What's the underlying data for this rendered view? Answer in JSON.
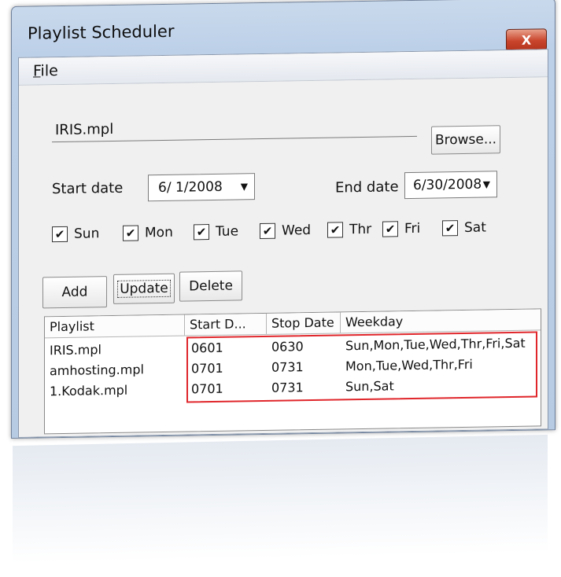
{
  "window": {
    "title": "Playlist Scheduler",
    "close_label": "X"
  },
  "menu": {
    "file_accel": "F",
    "file_rest": "ile"
  },
  "form": {
    "playlist_path": "IRIS.mpl",
    "browse_label": "Browse...",
    "start_date_label": "Start date",
    "start_date_value": "6/  1/2008",
    "end_date_label": "End date",
    "end_date_value": "6/30/2008",
    "dropdown_arrow": "▼"
  },
  "weekdays": [
    {
      "label": "Sun",
      "checked": true
    },
    {
      "label": "Mon",
      "checked": true
    },
    {
      "label": "Tue",
      "checked": true
    },
    {
      "label": "Wed",
      "checked": true
    },
    {
      "label": "Thr",
      "checked": true
    },
    {
      "label": "Fri",
      "checked": true
    },
    {
      "label": "Sat",
      "checked": true
    }
  ],
  "check_mark": "✔",
  "buttons": {
    "add": "Add",
    "update": "Update",
    "delete": "Delete"
  },
  "table": {
    "columns": [
      "Playlist",
      "Start D...",
      "Stop Date",
      "Weekday"
    ],
    "rows": [
      {
        "playlist": "IRIS.mpl",
        "start": "0601",
        "stop": "0630",
        "weekday": "Sun,Mon,Tue,Wed,Thr,Fri,Sat"
      },
      {
        "playlist": "amhosting.mpl",
        "start": "0701",
        "stop": "0731",
        "weekday": "Mon,Tue,Wed,Thr,Fri"
      },
      {
        "playlist": "1.Kodak.mpl",
        "start": "0701",
        "stop": "0731",
        "weekday": "Sun,Sat"
      }
    ]
  },
  "colors": {
    "highlight": "#e0262b",
    "close_button": "#c9452c"
  }
}
